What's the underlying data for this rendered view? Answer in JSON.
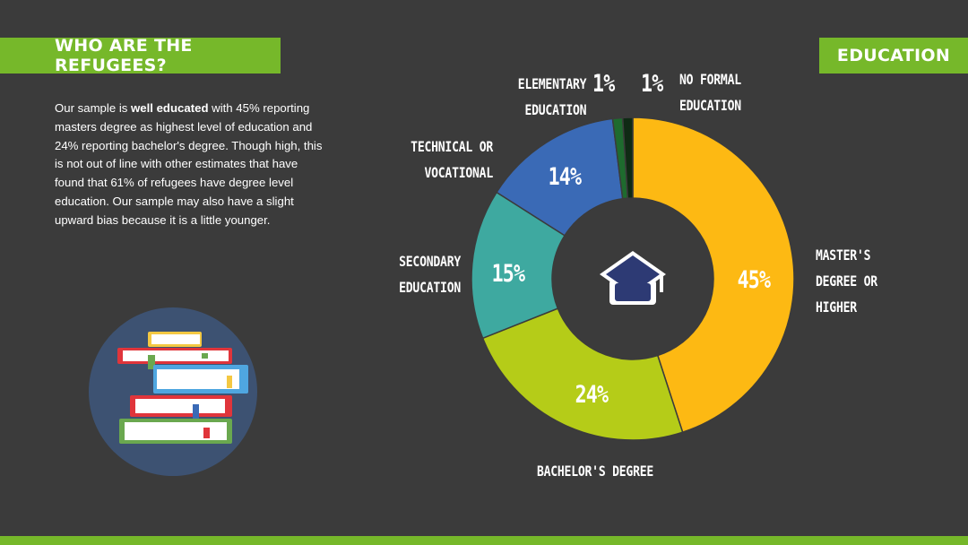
{
  "header": {
    "title": "WHO ARE THE REFUGEES?",
    "section": "EDUCATION"
  },
  "intro": {
    "pre": "Our sample is ",
    "bold": "well educated",
    "post": " with 45% reporting masters degree as highest level of education and 24% reporting bachelor's degree. Though high, this is not out of line with other estimates that have found that 61% of refugees have degree level education. Our sample may also have a slight upward bias because it is a little younger."
  },
  "chart_data": {
    "type": "pie",
    "title": "",
    "slices": [
      {
        "label": "MASTER'S DEGREE OR HIGHER",
        "value": 45,
        "display": "45%",
        "color": "#fdb913"
      },
      {
        "label": "BACHELOR'S DEGREE",
        "value": 24,
        "display": "24%",
        "color": "#b5cc18"
      },
      {
        "label": "SECONDARY EDUCATION",
        "value": 15,
        "display": "15%",
        "color": "#3ea9a0"
      },
      {
        "label": "TECHNICAL OR VOCATIONAL",
        "value": 14,
        "display": "14%",
        "color": "#3a6ab6"
      },
      {
        "label": "ELEMENTARY EDUCATION",
        "value": 1,
        "display": "1%",
        "color": "#1e6b2e"
      },
      {
        "label": "NO FORMAL EDUCATION",
        "value": 1,
        "display": "1%",
        "color": "#0f2a14"
      }
    ],
    "donut": true,
    "center_icon": "graduation-cap-icon"
  },
  "labels": {
    "masters": [
      "MASTER'S",
      "DEGREE OR",
      "HIGHER"
    ],
    "bachelors": [
      "BACHELOR'S DEGREE"
    ],
    "secondary": [
      "SECONDARY",
      "EDUCATION"
    ],
    "technical": [
      "TECHNICAL OR",
      "VOCATIONAL"
    ],
    "elementary": [
      "ELEMENTARY",
      "EDUCATION"
    ],
    "noformal": [
      "NO FORMAL",
      "EDUCATION"
    ]
  },
  "icons": {
    "books": "books-stack-icon",
    "cap": "graduation-cap-icon"
  },
  "colors": {
    "accent": "#76b82a",
    "background": "#3b3b3b"
  }
}
